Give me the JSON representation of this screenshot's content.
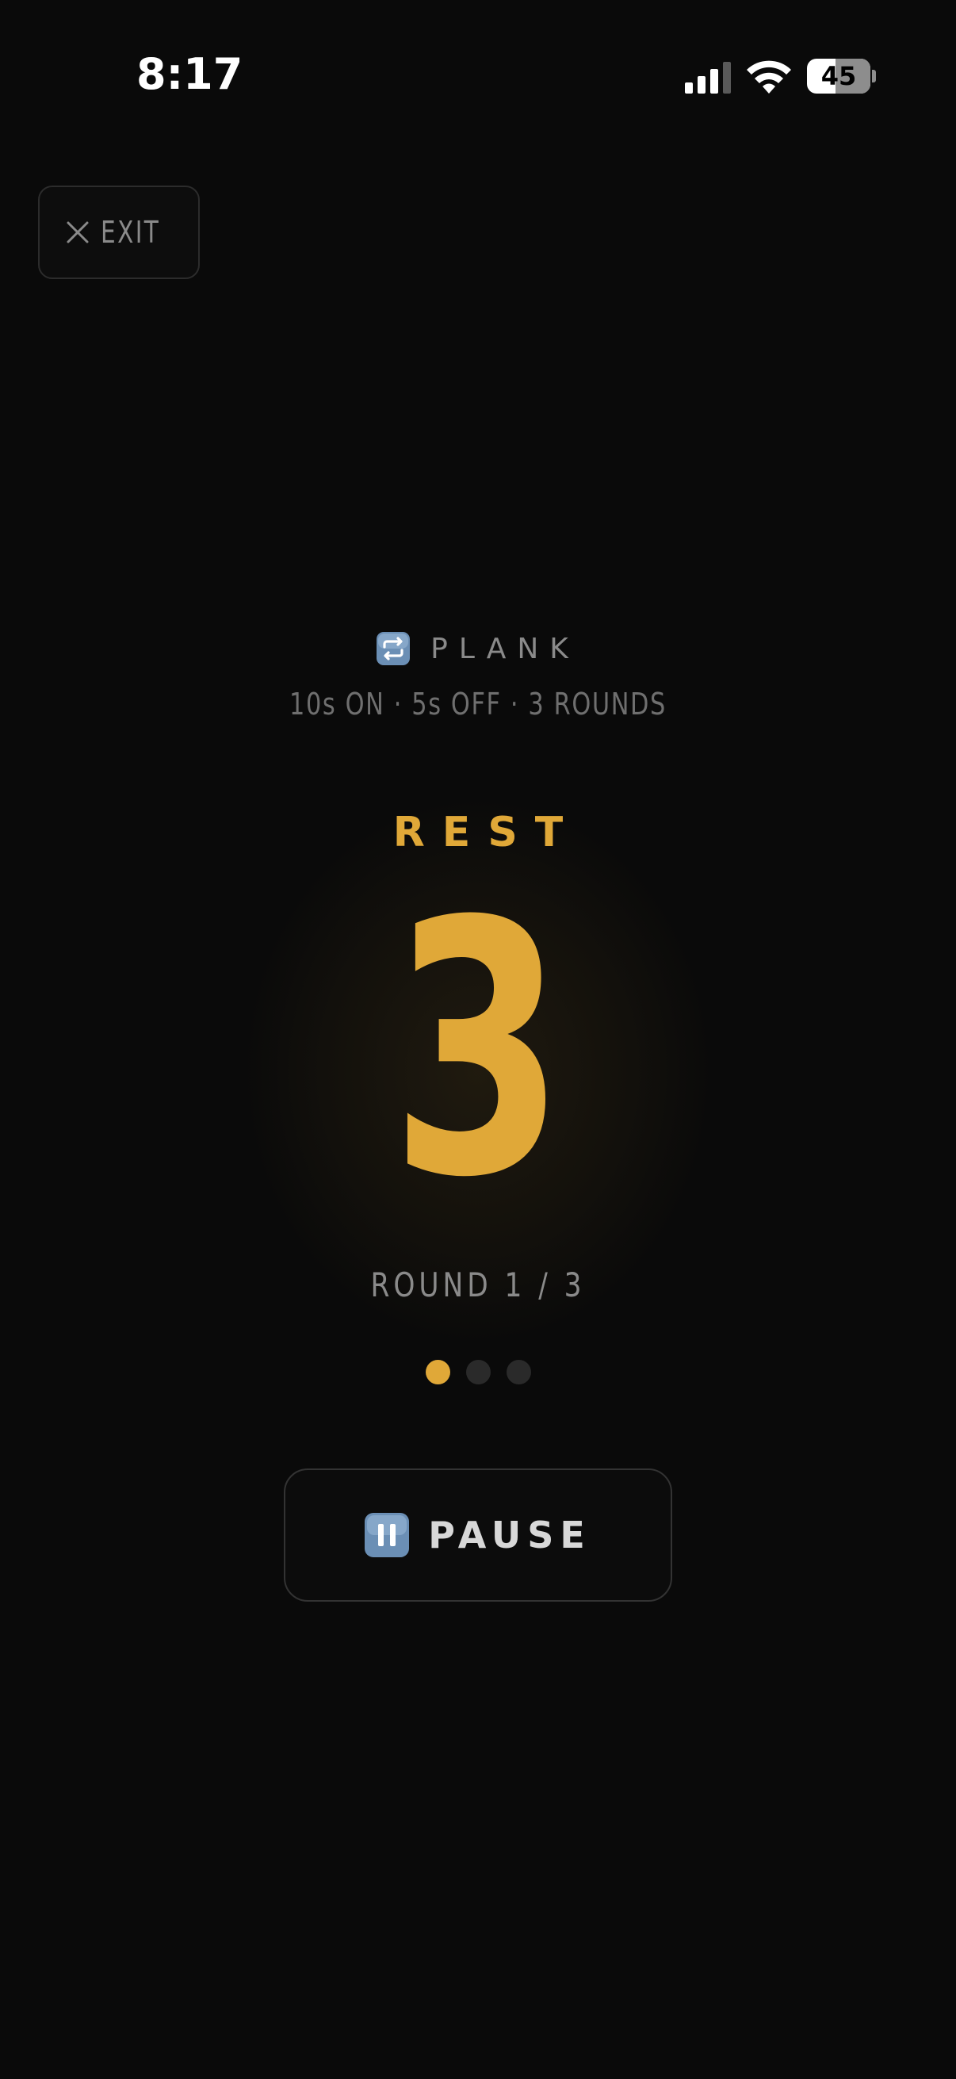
{
  "status_bar": {
    "time": "8:17",
    "battery_level": "45",
    "battery_fraction": 0.45
  },
  "exit_button": {
    "label": "EXIT",
    "icon": "close-icon"
  },
  "workout": {
    "icon": "repeat-icon",
    "name": "PLANK",
    "config": "10s ON · 5s OFF · 3 ROUNDS",
    "phase": "REST",
    "countdown": "3",
    "round_label": "ROUND 1 / 3",
    "rounds_total": 3,
    "round_current": 1
  },
  "pause_button": {
    "label": "PAUSE",
    "icon": "pause-icon"
  },
  "colors": {
    "background": "#0a0a0a",
    "accent": "#e0a838",
    "muted_text": "#8a8a8a",
    "inactive_dot": "#2a2a2a"
  }
}
